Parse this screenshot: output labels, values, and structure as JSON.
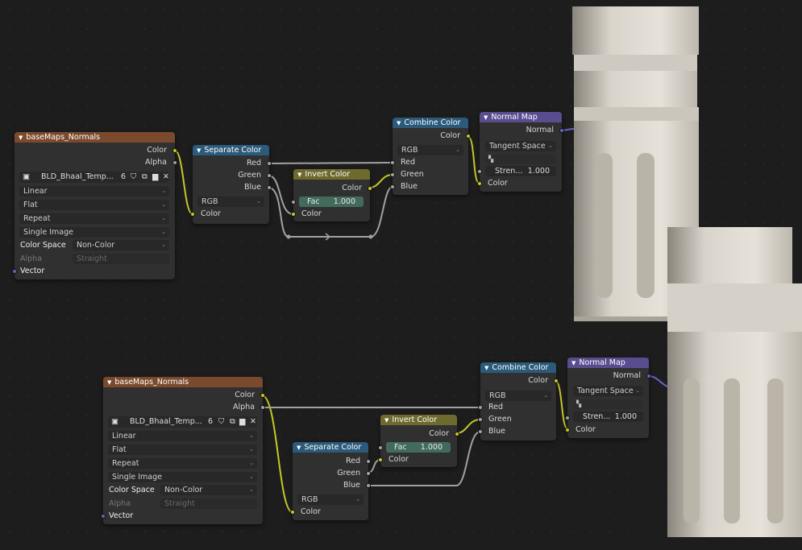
{
  "colors": {
    "texture_header": "#7b4a2c",
    "converter_header": "#2b5a7a",
    "color_header": "#6e6a2e",
    "vector_header": "#5a4d8f",
    "wire_color": "#c7c729",
    "wire_gray": "#a1a1a1",
    "wire_vector": "#6363c7"
  },
  "group1": {
    "image_node": {
      "title": "baseMaps_Normals",
      "out_color": "Color",
      "out_alpha": "Alpha",
      "image_name": "BLD_Bhaal_Temp...",
      "users": "6",
      "interpolation": "Linear",
      "projection": "Flat",
      "extension": "Repeat",
      "source": "Single Image",
      "color_space_label": "Color Space",
      "color_space_value": "Non-Color",
      "alpha_label": "Alpha",
      "alpha_value": "Straight",
      "vector": "Vector"
    },
    "separate": {
      "title": "Separate Color",
      "red": "Red",
      "green": "Green",
      "blue": "Blue",
      "mode": "RGB",
      "in_color": "Color"
    },
    "invert": {
      "title": "Invert Color",
      "out_color": "Color",
      "fac_label": "Fac",
      "fac_value": "1.000",
      "in_color": "Color"
    },
    "combine": {
      "title": "Combine Color",
      "out_color": "Color",
      "mode": "RGB",
      "red": "Red",
      "green": "Green",
      "blue": "Blue"
    },
    "normal": {
      "title": "Normal Map",
      "out_normal": "Normal",
      "space": "Tangent Space",
      "strength_label": "Stren...",
      "strength_value": "1.000",
      "in_color": "Color"
    }
  },
  "group2": {
    "image_node": {
      "title": "baseMaps_Normals",
      "out_color": "Color",
      "out_alpha": "Alpha",
      "image_name": "BLD_Bhaal_Temp...",
      "users": "6",
      "interpolation": "Linear",
      "projection": "Flat",
      "extension": "Repeat",
      "source": "Single Image",
      "color_space_label": "Color Space",
      "color_space_value": "Non-Color",
      "alpha_label": "Alpha",
      "alpha_value": "Straight",
      "vector": "Vector"
    },
    "separate": {
      "title": "Separate Color",
      "red": "Red",
      "green": "Green",
      "blue": "Blue",
      "mode": "RGB",
      "in_color": "Color"
    },
    "invert": {
      "title": "Invert Color",
      "out_color": "Color",
      "fac_label": "Fac",
      "fac_value": "1.000",
      "in_color": "Color"
    },
    "combine": {
      "title": "Combine Color",
      "out_color": "Color",
      "mode": "RGB",
      "red": "Red",
      "green": "Green",
      "blue": "Blue"
    },
    "normal": {
      "title": "Normal Map",
      "out_normal": "Normal",
      "space": "Tangent Space",
      "strength_label": "Stren...",
      "strength_value": "1.000",
      "in_color": "Color"
    }
  },
  "icons": {
    "collapse": "chevron-down-icon",
    "image": "image-icon",
    "fake_user": "shield-icon",
    "duplicate": "duplicate-icon",
    "open": "folder-icon",
    "unlink": "close-icon",
    "uv_map": "uv-map-icon"
  }
}
